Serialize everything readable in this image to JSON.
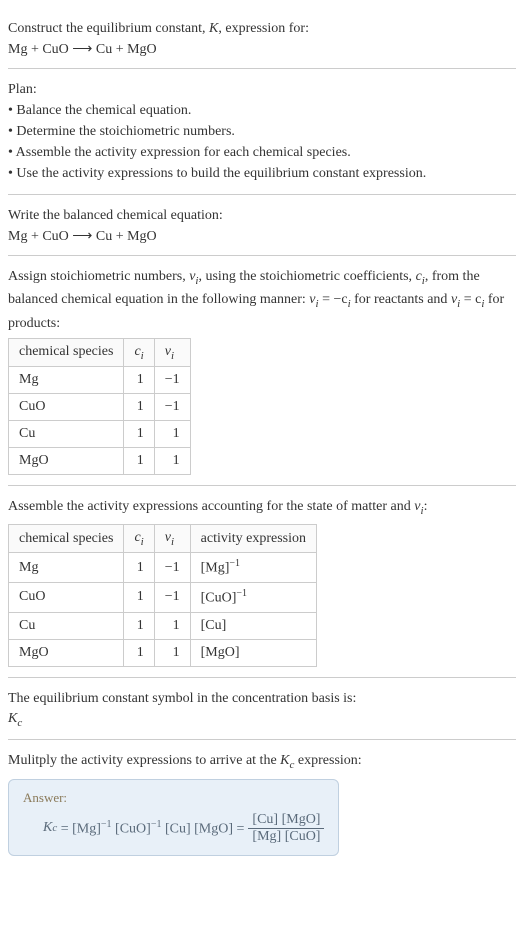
{
  "intro": {
    "line1": "Construct the equilibrium constant, ",
    "K": "K",
    "line1b": ", expression for:",
    "equation": "Mg + CuO ⟶ Cu + MgO"
  },
  "plan": {
    "heading": "Plan:",
    "items": [
      "• Balance the chemical equation.",
      "• Determine the stoichiometric numbers.",
      "• Assemble the activity expression for each chemical species.",
      "• Use the activity expressions to build the equilibrium constant expression."
    ]
  },
  "balanced": {
    "heading": "Write the balanced chemical equation:",
    "equation": "Mg + CuO ⟶ Cu + MgO"
  },
  "stoich": {
    "text1": "Assign stoichiometric numbers, ",
    "ni": "ν",
    "ni_sub": "i",
    "text2": ", using the stoichiometric coefficients, ",
    "ci": "c",
    "ci_sub": "i",
    "text3": ", from the balanced chemical equation in the following manner: ",
    "eq1": "ν",
    "eq1_sub": "i",
    "eq1b": " = −c",
    "eq1b_sub": "i",
    "text4": " for reactants and ",
    "eq2": "ν",
    "eq2_sub": "i",
    "eq2b": " = c",
    "eq2b_sub": "i",
    "text5": " for products:",
    "headers": [
      "chemical species",
      "cᵢ",
      "νᵢ"
    ],
    "rows": [
      {
        "species": "Mg",
        "c": "1",
        "n": "−1"
      },
      {
        "species": "CuO",
        "c": "1",
        "n": "−1"
      },
      {
        "species": "Cu",
        "c": "1",
        "n": "1"
      },
      {
        "species": "MgO",
        "c": "1",
        "n": "1"
      }
    ]
  },
  "activity": {
    "heading": "Assemble the activity expressions accounting for the state of matter and ",
    "ni": "ν",
    "ni_sub": "i",
    "heading2": ":",
    "headers": [
      "chemical species",
      "cᵢ",
      "νᵢ",
      "activity expression"
    ],
    "rows": [
      {
        "species": "Mg",
        "c": "1",
        "n": "−1",
        "a": "[Mg]⁻¹"
      },
      {
        "species": "CuO",
        "c": "1",
        "n": "−1",
        "a": "[CuO]⁻¹"
      },
      {
        "species": "Cu",
        "c": "1",
        "n": "1",
        "a": "[Cu]"
      },
      {
        "species": "MgO",
        "c": "1",
        "n": "1",
        "a": "[MgO]"
      }
    ]
  },
  "symbol": {
    "heading": "The equilibrium constant symbol in the concentration basis is:",
    "Kc": "K",
    "Kc_sub": "c"
  },
  "multiply": {
    "heading": "Mulitply the activity expressions to arrive at the ",
    "Kc": "K",
    "Kc_sub": "c",
    "heading2": " expression:"
  },
  "answer": {
    "label": "Answer:",
    "lhs": "K",
    "lhs_sub": "c",
    "eq": " = [Mg]⁻¹ [CuO]⁻¹ [Cu] [MgO] = ",
    "num": "[Cu] [MgO]",
    "den": "[Mg] [CuO]"
  }
}
